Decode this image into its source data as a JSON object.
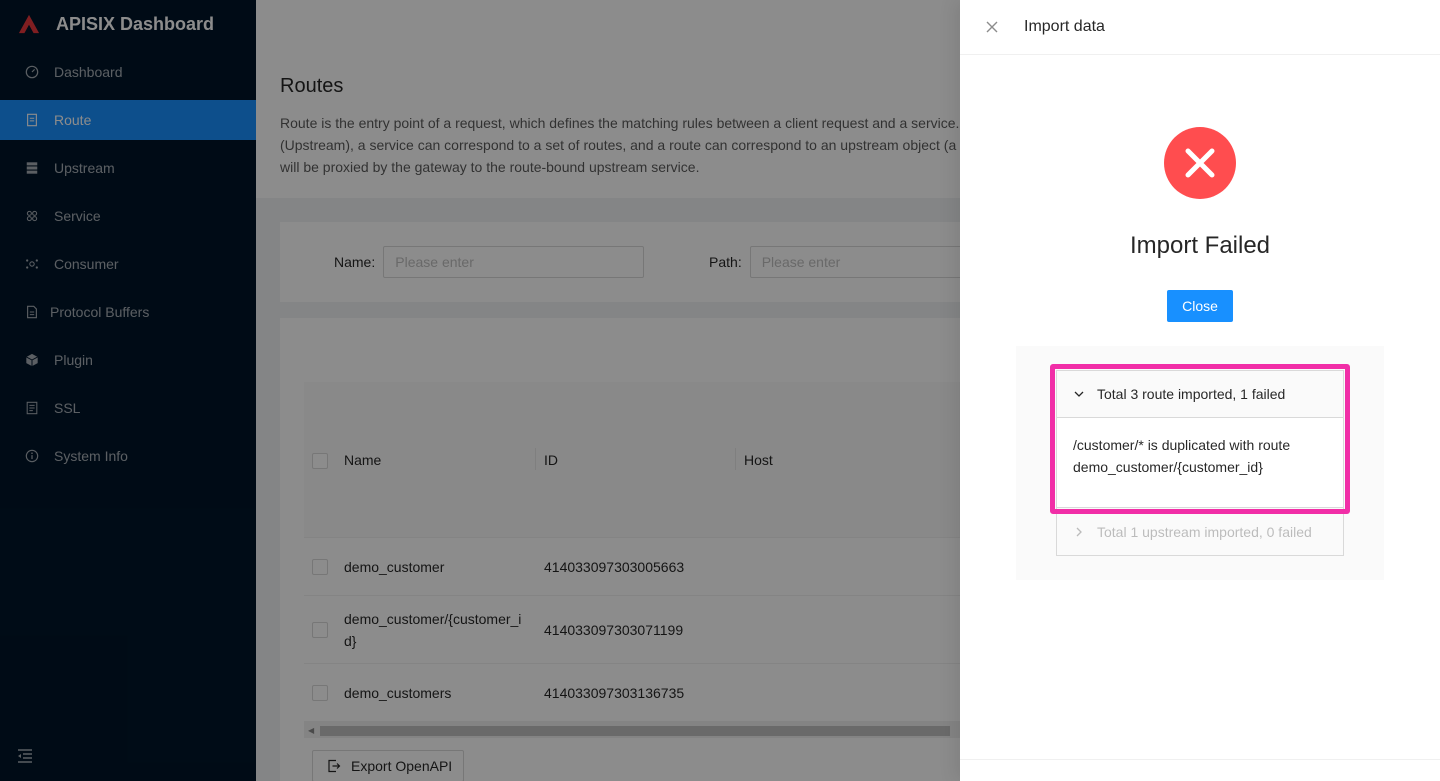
{
  "app": {
    "title": "APISIX Dashboard"
  },
  "sidebar": {
    "items": [
      {
        "label": "Dashboard",
        "icon": "dashboard-icon"
      },
      {
        "label": "Route",
        "icon": "file-icon",
        "active": true
      },
      {
        "label": "Upstream",
        "icon": "database-icon"
      },
      {
        "label": "Service",
        "icon": "cluster-icon"
      },
      {
        "label": "Consumer",
        "icon": "team-icon"
      },
      {
        "label": "Protocol Buffers",
        "icon": "file-text-icon"
      },
      {
        "label": "Plugin",
        "icon": "codesandbox-icon"
      },
      {
        "label": "SSL",
        "icon": "safety-certificate-icon"
      },
      {
        "label": "System Info",
        "icon": "info-circle-icon"
      }
    ]
  },
  "page": {
    "title": "Routes",
    "description": "Route is the entry point of a request, which defines the matching rules between a client request and a service. A route can be associated with a service (Service), an upstream (Upstream), a service can correspond to a set of routes, and a route can correspond to an upstream object (a set of backend service nodes), so each request matching to a route will be proxied by the gateway to the route-bound upstream service."
  },
  "search": {
    "name_label": "Name",
    "name_placeholder": "Please enter",
    "path_label": "Path",
    "path_placeholder": "Please enter"
  },
  "table": {
    "columns": [
      "Name",
      "ID",
      "Host"
    ],
    "rows": [
      {
        "name": "demo_customer",
        "id": "414033097303005663"
      },
      {
        "name": "demo_customer/{customer_id}",
        "id": "414033097303071199"
      },
      {
        "name": "demo_customers",
        "id": "414033097303136735"
      }
    ],
    "export_label": "Export OpenAPI"
  },
  "drawer": {
    "title": "Import data",
    "result_title": "Import Failed",
    "close_label": "Close",
    "panels": [
      {
        "header": "Total 3 route imported, 1 failed",
        "body": "/customer/* is duplicated with route demo_customer/{customer_id}",
        "expanded": true
      },
      {
        "header": "Total 1 upstream imported, 0 failed",
        "expanded": false
      }
    ]
  },
  "colors": {
    "primary": "#1890ff",
    "error": "#ff4d4f",
    "sider": "#001529",
    "highlight": "#f12ea7"
  }
}
